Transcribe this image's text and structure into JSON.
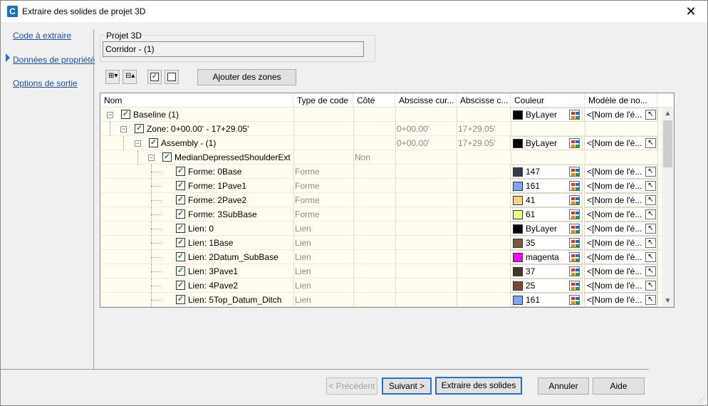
{
  "window": {
    "title": "Extraire des solides de projet 3D",
    "close_glyph": "✕"
  },
  "nav": {
    "items": [
      "Code à extraire",
      "Données de propriété",
      "Options de sortie"
    ]
  },
  "project": {
    "group_label": "Projet 3D",
    "value": "Corridor - (1)"
  },
  "toolbar": {
    "add_zones_label": "Ajouter des zones"
  },
  "grid": {
    "columns": [
      "Nom",
      "Type de code",
      "Côté",
      "Abscisse cur...",
      "Abscisse c...",
      "Couleur",
      "Modèle de no..."
    ],
    "rows": [
      {
        "name": "Baseline (1)",
        "level": 0,
        "expander": "−",
        "type": "",
        "side": "",
        "start": "",
        "end": "",
        "color": "ByLayer",
        "swatch": "#000000",
        "model": "<[Nom de l'é..."
      },
      {
        "name": "Zone: 0+00.00' - 17+29.05'",
        "level": 1,
        "expander": "−",
        "type": "",
        "side": "",
        "start": "0+00.00'",
        "end": "17+29.05'",
        "color": "",
        "swatch": "",
        "model": ""
      },
      {
        "name": "Assembly - (1)",
        "level": 2,
        "expander": "−",
        "type": "",
        "side": "",
        "start": "0+00.00'",
        "end": "17+29.05'",
        "color": "ByLayer",
        "swatch": "#000000",
        "model": "<[Nom de l'é..."
      },
      {
        "name": "MedianDepressedShoulderExt",
        "level": 3,
        "expander": "−",
        "type": "",
        "side": "Non",
        "start": "",
        "end": "",
        "color": "",
        "swatch": "",
        "model": ""
      },
      {
        "name": "Forme: 0Base",
        "level": 4,
        "expander": "",
        "type": "Forme",
        "side": "",
        "start": "",
        "end": "",
        "color": "147",
        "swatch": "#2e3f4a",
        "model": "<[Nom de l'é..."
      },
      {
        "name": "Forme: 1Pave1",
        "level": 4,
        "expander": "",
        "type": "Forme",
        "side": "",
        "start": "",
        "end": "",
        "color": "161",
        "swatch": "#7ea6f0",
        "model": "<[Nom de l'é..."
      },
      {
        "name": "Forme: 2Pave2",
        "level": 4,
        "expander": "",
        "type": "Forme",
        "side": "",
        "start": "",
        "end": "",
        "color": "41",
        "swatch": "#ffd27f",
        "model": "<[Nom de l'é..."
      },
      {
        "name": "Forme: 3SubBase",
        "level": 4,
        "expander": "",
        "type": "Forme",
        "side": "",
        "start": "",
        "end": "",
        "color": "61",
        "swatch": "#eeff7f",
        "model": "<[Nom de l'é..."
      },
      {
        "name": "Lien: 0",
        "level": 4,
        "expander": "",
        "type": "Lien",
        "side": "",
        "start": "",
        "end": "",
        "color": "ByLayer",
        "swatch": "#000000",
        "model": "<[Nom de l'é..."
      },
      {
        "name": "Lien: 1Base",
        "level": 4,
        "expander": "",
        "type": "Lien",
        "side": "",
        "start": "",
        "end": "",
        "color": "35",
        "swatch": "#7a5a3c",
        "model": "<[Nom de l'é..."
      },
      {
        "name": "Lien: 2Datum_SubBase",
        "level": 4,
        "expander": "",
        "type": "Lien",
        "side": "",
        "start": "",
        "end": "",
        "color": "magenta",
        "swatch": "#ff00ff",
        "model": "<[Nom de l'é..."
      },
      {
        "name": "Lien: 3Pave1",
        "level": 4,
        "expander": "",
        "type": "Lien",
        "side": "",
        "start": "",
        "end": "",
        "color": "37",
        "swatch": "#4a3426",
        "model": "<[Nom de l'é..."
      },
      {
        "name": "Lien: 4Pave2",
        "level": 4,
        "expander": "",
        "type": "Lien",
        "side": "",
        "start": "",
        "end": "",
        "color": "25",
        "swatch": "#7a4a34",
        "model": "<[Nom de l'é..."
      },
      {
        "name": "Lien: 5Top_Datum_Ditch",
        "level": 4,
        "expander": "",
        "type": "Lien",
        "side": "",
        "start": "",
        "end": "",
        "color": "161",
        "swatch": "#7ea6f0",
        "model": "<[Nom de l'é..."
      }
    ]
  },
  "footer": {
    "prev_label": "< Précédent",
    "next_label": "Suivant >",
    "extract_label": "Extraire des solides",
    "cancel_label": "Annuler",
    "help_label": "Aide"
  }
}
